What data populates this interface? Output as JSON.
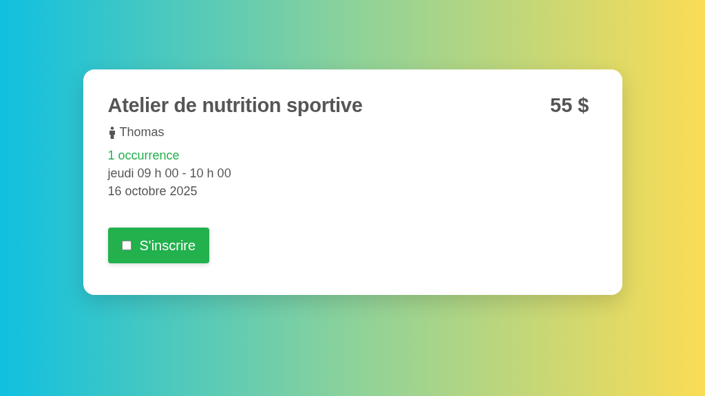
{
  "card": {
    "title": "Atelier de nutrition sportive",
    "price": "55 $",
    "instructor": "Thomas",
    "occurrences": "1 occurrence",
    "schedule": "jeudi 09 h 00 - 10 h 00",
    "date": "16 octobre 2025",
    "register_button": {
      "label": "S'inscrire",
      "checked": false
    }
  }
}
